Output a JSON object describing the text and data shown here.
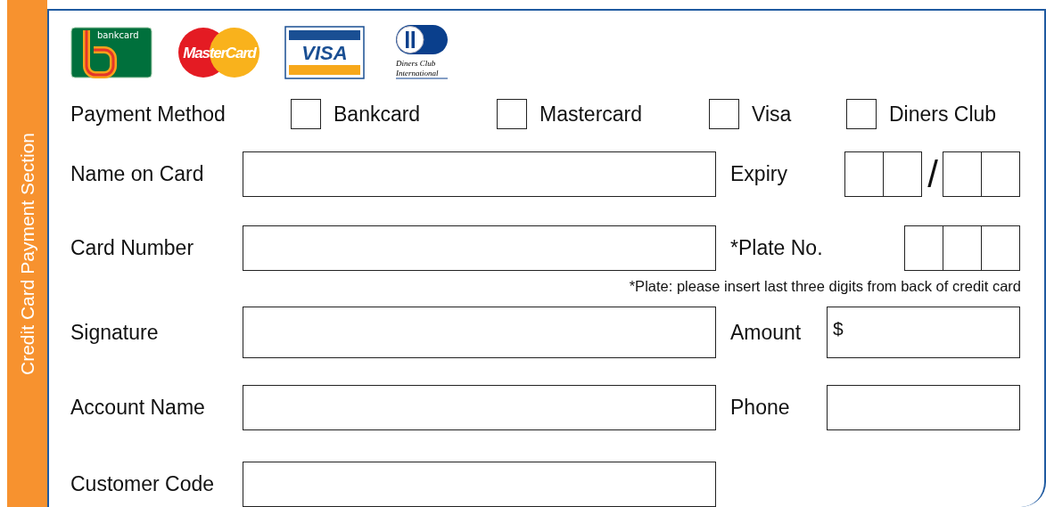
{
  "side_label": "Credit Card Payment Section",
  "logos": [
    {
      "kind": "bankcard",
      "lines": [
        "bankcard"
      ]
    },
    {
      "kind": "mastercard",
      "lines": [
        "MasterCard"
      ]
    },
    {
      "kind": "visa",
      "lines": [
        "VISA"
      ]
    },
    {
      "kind": "diners",
      "lines": [
        "Diners Club",
        "International"
      ]
    }
  ],
  "payment_method": {
    "label": "Payment Method",
    "options": [
      {
        "label": "Bankcard",
        "checked": false
      },
      {
        "label": "Mastercard",
        "checked": false
      },
      {
        "label": "Visa",
        "checked": false
      },
      {
        "label": "Diners Club",
        "checked": false
      }
    ]
  },
  "rows": [
    {
      "label": "Name on Card",
      "right": {
        "label": "Expiry",
        "kind": "expiry",
        "separator": "/"
      }
    },
    {
      "label": "Card Number",
      "right": {
        "label": "*Plate No.",
        "kind": "plate"
      },
      "note": "*Plate: please insert last three digits from back of credit card"
    },
    {
      "label": "Signature",
      "right": {
        "label": "Amount",
        "kind": "amount",
        "prefix": "$"
      }
    },
    {
      "label": "Account Name",
      "right": {
        "label": "Phone",
        "kind": "phone"
      }
    },
    {
      "label": "Customer Code"
    }
  ]
}
